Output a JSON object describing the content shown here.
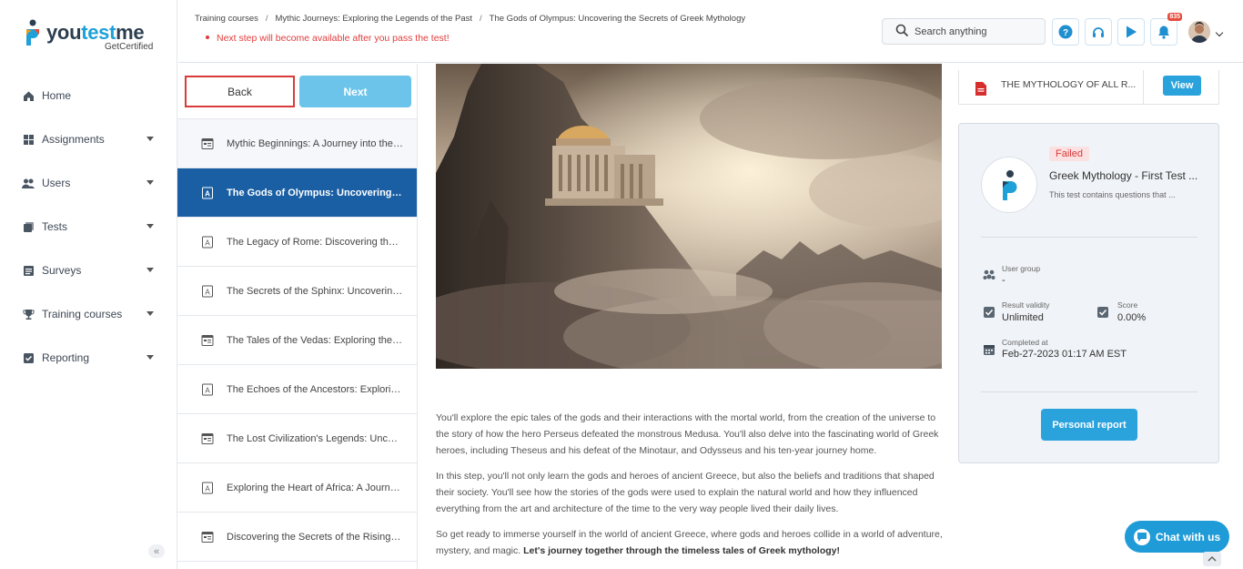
{
  "logo": {
    "brand_a": "you",
    "brand_b": "test",
    "brand_c": "me",
    "sub": "GetCertified"
  },
  "sidebar": {
    "items": [
      {
        "label": "Home",
        "icon": "home-icon"
      },
      {
        "label": "Assignments",
        "icon": "assignments-icon"
      },
      {
        "label": "Users",
        "icon": "users-icon"
      },
      {
        "label": "Tests",
        "icon": "tests-icon"
      },
      {
        "label": "Surveys",
        "icon": "surveys-icon"
      },
      {
        "label": "Training courses",
        "icon": "trophy-icon"
      },
      {
        "label": "Reporting",
        "icon": "reporting-icon"
      }
    ],
    "collapse": "«"
  },
  "header": {
    "breadcrumb": [
      "Training courses",
      "Mythic Journeys: Exploring the Legends of the Past",
      "The Gods of Olympus: Uncovering the Secrets of Greek Mythology"
    ],
    "separator": "/",
    "warning": "Next step will become available after you pass the test!",
    "search_placeholder": "Search anything",
    "notification_count": "835"
  },
  "steps": {
    "back_label": "Back",
    "next_label": "Next",
    "items": [
      {
        "label": "Mythic Beginnings: A Journey into the Origins of Legends",
        "icon": "lesson-icon"
      },
      {
        "label": "The Gods of Olympus: Uncovering the Secrets of Greek Mythology",
        "icon": "document-icon"
      },
      {
        "label": "The Legacy of Rome: Discovering the Myths of the Empire",
        "icon": "document-icon"
      },
      {
        "label": "The Secrets of the Sphinx: Uncovering Egyptian Myths",
        "icon": "document-icon"
      },
      {
        "label": "The Tales of the Vedas: Exploring the Myths of India",
        "icon": "lesson-icon"
      },
      {
        "label": "The Echoes of the Ancestors: Exploring Native Legends",
        "icon": "document-icon"
      },
      {
        "label": "The Lost Civilization's Legends: Uncovering Hidden Myths",
        "icon": "lesson-icon"
      },
      {
        "label": "Exploring the Heart of Africa: A Journey Through Myths",
        "icon": "document-icon"
      },
      {
        "label": "Discovering the Secrets of the Rising Sun",
        "icon": "lesson-icon"
      }
    ]
  },
  "content": {
    "p1": "You'll explore the epic tales of the gods and their interactions with the mortal world, from the creation of the universe to the story of how the hero Perseus defeated the monstrous Medusa. You'll also delve into the fascinating world of Greek heroes, including Theseus and his defeat of the Minotaur, and Odysseus and his ten-year journey home.",
    "p2": "In this step, you'll not only learn the gods and heroes of ancient Greece, but also the beliefs and traditions that shaped their society. You'll see how the stories of the gods were used to explain the natural world and how they influenced everything from the art and architecture of the time to the very way people lived their daily lives.",
    "p3": "So get ready to immerse yourself in the world of ancient Greece, where gods and heroes collide in a world of adventure, mystery, and magic.",
    "p3_bold": "Let's journey together through the timeless tales of Greek mythology!"
  },
  "attachment": {
    "name": "THE MYTHOLOGY OF ALL R...",
    "view_label": "View"
  },
  "test_card": {
    "status": "Failed",
    "title": "Greek Mythology - First Test ...",
    "description": "This test contains questions that ...",
    "user_group_label": "User group",
    "user_group_value": "-",
    "validity_label": "Result validity",
    "validity_value": "Unlimited",
    "score_label": "Score",
    "score_value": "0.00%",
    "completed_label": "Completed at",
    "completed_value": "Feb-27-2023 01:17 AM EST",
    "report_label": "Personal report"
  },
  "chat": {
    "label": "Chat with us"
  },
  "colors": {
    "accent": "#2aa3dd",
    "active": "#1a5fa3",
    "danger": "#d93a3a"
  }
}
